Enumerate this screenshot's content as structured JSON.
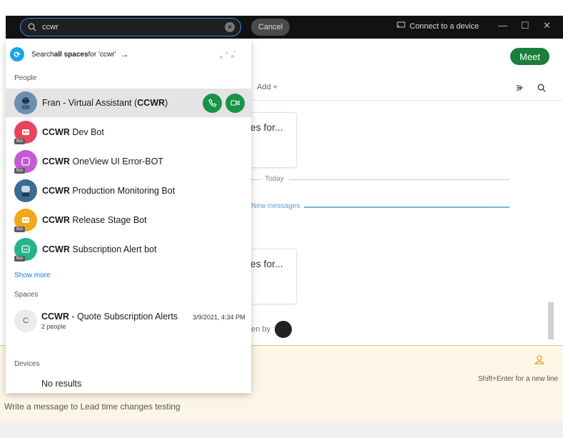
{
  "topbar": {
    "search_value": "ccwr",
    "cancel_label": "Cancel",
    "connect_label": "Connect to a device"
  },
  "dropdown": {
    "search_all": {
      "prefix": "Search ",
      "bold": "all spaces",
      "suffix": " for 'ccwr'",
      "arrow": "→"
    },
    "people_label": "People",
    "people": [
      {
        "name_plain": "Fran - Virtual Assistant (",
        "name_bold": "CCWR",
        "name_suffix": ")",
        "badge": "",
        "avatar_color": "#6c8fb0"
      },
      {
        "name_bold": "CCWR",
        "name_plain": " Dev Bot",
        "badge": "Bot",
        "avatar_color": "#e8455d"
      },
      {
        "name_bold": "CCWR",
        "name_plain": " OneView UI Error-BOT",
        "badge": "Bot",
        "avatar_color": "#c45ad6"
      },
      {
        "name_bold": "CCWR",
        "name_plain": " Production Monitoring Bot",
        "badge": "",
        "avatar_color": "#3b6c8f"
      },
      {
        "name_bold": "CCWR",
        "name_plain": " Release Stage Bot",
        "badge": "Bot",
        "avatar_color": "#f2a818"
      },
      {
        "name_bold": "CCWR",
        "name_plain": " Subscription Alert bot",
        "badge": "Bot",
        "avatar_color": "#27b38a"
      }
    ],
    "show_more": "Show more",
    "spaces_label": "Spaces",
    "space": {
      "initial": "C",
      "title_bold": "CCWR",
      "title_plain": " - Quote Subscription Alerts",
      "subtitle": "2 people",
      "time": "3/9/2021, 4:34 PM"
    },
    "devices_label": "Devices",
    "no_results": "No results"
  },
  "conversation": {
    "meet_label": "Meet",
    "add_label": "Add +",
    "card_text_1": "ges for...",
    "card_text_2": "ges for...",
    "today_label": "Today",
    "new_messages_label": "New messages",
    "seen_by_label": "een by",
    "shift_hint": "Shift+Enter for a new line",
    "compose_placeholder": "Write a message to Lead time changes testing"
  },
  "colors": {
    "accent_blue": "#2d8cf0",
    "call_green": "#1a9348",
    "meet_green": "#1a7f3c",
    "compose_bg": "#fdf6e6",
    "compose_border": "#f2c46b",
    "new_messages_blue": "#79b7e5"
  }
}
